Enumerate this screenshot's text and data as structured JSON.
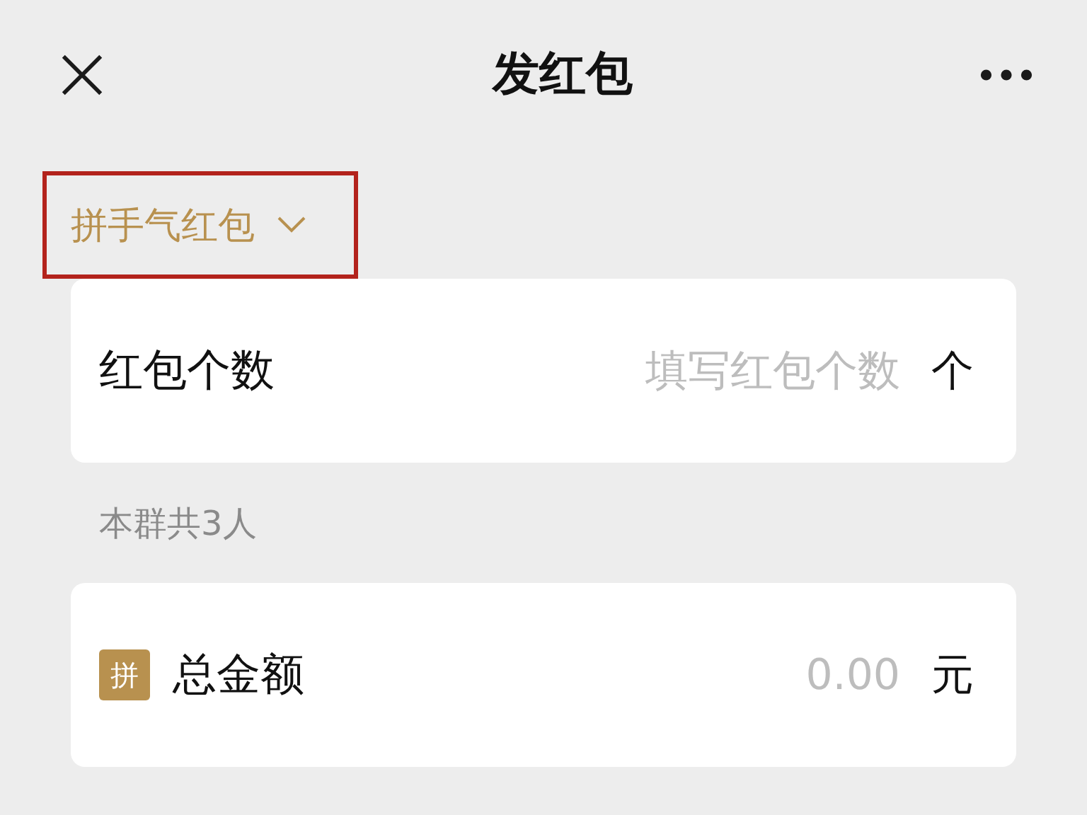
{
  "header": {
    "title": "发红包"
  },
  "packet_type": {
    "label": "拼手气红包",
    "highlighted": true
  },
  "count_card": {
    "label": "红包个数",
    "placeholder": "填写红包个数",
    "unit": "个"
  },
  "group_note": "本群共3人",
  "amount_card": {
    "badge": "拼",
    "label": "总金额",
    "placeholder": "0.00",
    "unit": "元"
  }
}
